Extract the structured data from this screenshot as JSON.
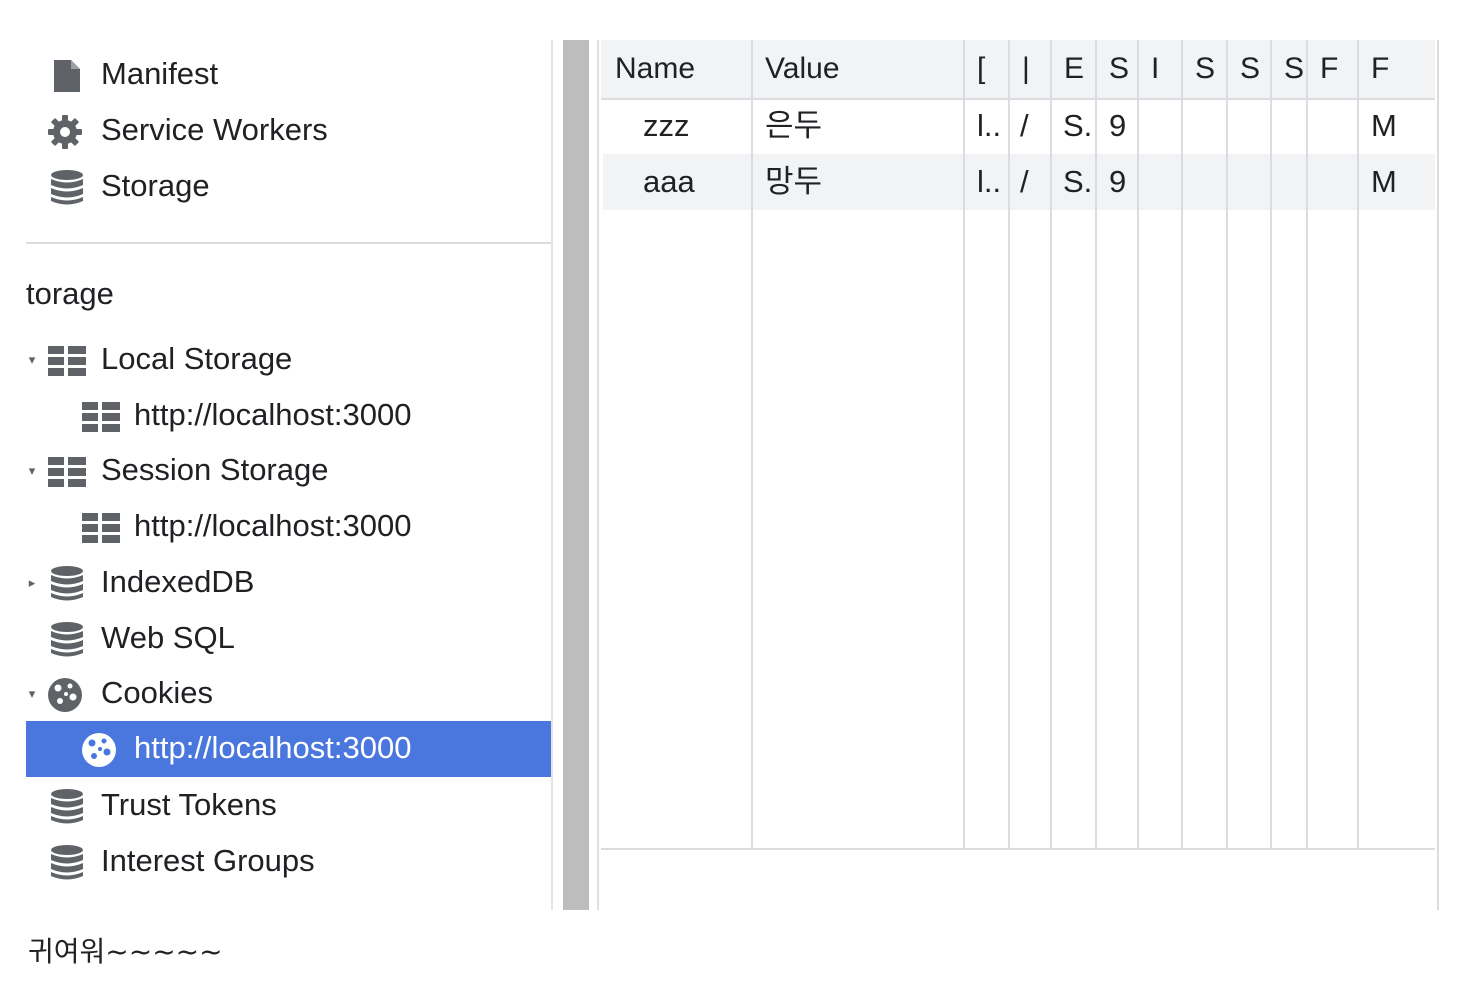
{
  "sidebar": {
    "manifest": "Manifest",
    "service_workers": "Service Workers",
    "storage": "Storage",
    "section_title": "torage",
    "local_storage": "Local Storage",
    "local_origin": "http://localhost:3000",
    "session_storage": "Session Storage",
    "session_origin": "http://localhost:3000",
    "indexeddb": "IndexedDB",
    "websql": "Web SQL",
    "cookies": "Cookies",
    "cookies_origin": "http://localhost:3000",
    "trust_tokens": "Trust Tokens",
    "interest_groups": "Interest Groups"
  },
  "tree_glyphs": {
    "expanded": "▾",
    "collapsed": "▸"
  },
  "colors": {
    "selected_bg": "#4a77dd",
    "header_bg": "#f1f3f4",
    "alt_row_bg": "#f1f3f4"
  },
  "cookie_table": {
    "columns": [
      "Name",
      "Value",
      "[",
      "|",
      "E",
      "S",
      "I",
      "S",
      "S",
      "S",
      "F",
      "F"
    ],
    "rows": [
      [
        "zzz",
        "은두",
        "l..",
        "/",
        "S.",
        "9",
        "",
        "",
        "",
        "",
        "",
        "M"
      ],
      [
        "aaa",
        "망두",
        "l..",
        "/",
        "S.",
        "9",
        "",
        "",
        "",
        "",
        "",
        "M"
      ]
    ]
  },
  "caption": "귀여워~~~~~"
}
